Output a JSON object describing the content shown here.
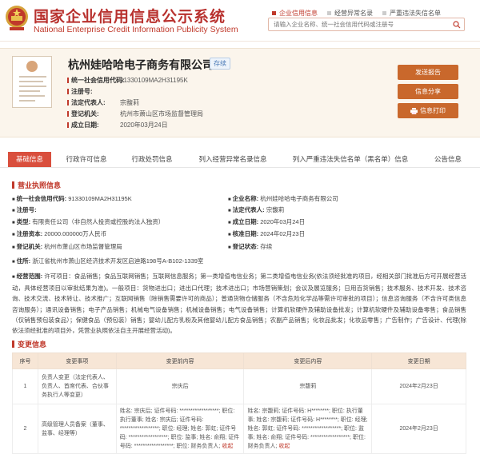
{
  "header": {
    "logo_cn": "国家企业信用信息公示系统",
    "logo_en": "National Enterprise Credit Information Publicity System",
    "nav": [
      "企业信用信息",
      "经营异常名录",
      "严重违法失信名单"
    ],
    "search_placeholder": "请输入企业名称、统一社会信用代码或注册号"
  },
  "company": {
    "name": "杭州娃哈哈电子商务有限公司",
    "status": "存续",
    "info": [
      {
        "label": "统一社会信用代码:",
        "value": "91330109MA2H31195K"
      },
      {
        "label": "注册号:",
        "value": ""
      },
      {
        "label": "法定代表人:",
        "value": "宗馥莉"
      },
      {
        "label": "登记机关:",
        "value": "杭州市萧山区市场监督管理局"
      },
      {
        "label": "成立日期:",
        "value": "2020年03月24日"
      }
    ],
    "buttons": [
      "发送报告",
      "信息分享",
      "信息打印"
    ]
  },
  "tabs": [
    "基础信息",
    "行政许可信息",
    "行政处罚信息",
    "列入经营异常名录信息",
    "列入严重违法失信名单（黑名单）信息",
    "公告信息"
  ],
  "license_section": {
    "title": "营业执照信息",
    "items": [
      {
        "label": "统一社会信用代码:",
        "value": "91330109MA2H31195K"
      },
      {
        "label": "企业名称:",
        "value": "杭州娃哈哈电子商务有限公司"
      },
      {
        "label": "注册号:",
        "value": ""
      },
      {
        "label": "法定代表人:",
        "value": "宗馥莉"
      },
      {
        "label": "类型:",
        "value": "有限责任公司（非自然人投资或控股的法人独资）"
      },
      {
        "label": "成立日期:",
        "value": "2020年03月24日"
      },
      {
        "label": "注册资本:",
        "value": "20000.000000万人民币"
      },
      {
        "label": "核准日期:",
        "value": "2024年02月23日"
      },
      {
        "label": "登记机关:",
        "value": "杭州市萧山区市场监督管理局"
      },
      {
        "label": "登记状态:",
        "value": "存续"
      },
      {
        "label": "住所:",
        "value": "浙江省杭州市萧山区经济技术开发区启迪路198号A-B102-1339室"
      }
    ],
    "scope_label": "经营范围:",
    "scope_text": "许可项目：食品销售；食品互联网销售；互联网信息服务；第一类增值电信业务；第二类增值电信业务(依法须经批准的项目，经相关部门批准后方可开展经营活动，具体经营项目以审批结果为准)。一般项目：货物进出口；进出口代理；技术进出口；市场营销策划；会议及展览服务；日用百货销售；技术服务、技术开发、技术咨询、技术交流、技术转让、技术推广；互联网销售（除销售需要许可的商品）；普通货物仓储服务（不含危险化学品等需许可审批的项目）；信息咨询服务（不含许可类信息咨询服务）；通讯设备销售；电子产品销售；机械电气设备销售；机械设备销售；电气设备销售；计算机软硬件及辅助设备批发；计算机软硬件及辅助设备零售；食品销售（仅销售预包装食品）；保健食品（预包装）销售；婴幼儿配方乳粉及其他婴幼儿配方食品销售；农副产品销售；化妆品批发；化妆品零售；广告制作；广告设计、代理(除依法须经批准的项目外，凭营业执照依法自主开展经营活动)。"
  },
  "change_section": {
    "title": "变更信息",
    "headers": [
      "序号",
      "变更事项",
      "变更前内容",
      "变更后内容",
      "变更日期"
    ],
    "rows": [
      {
        "no": "1",
        "item": "负责人变更（法定代表人、负责人、首席代表、合伙事务执行人等变更）",
        "before": "宗庆后",
        "after": "宗馥莉",
        "date": "2024年2月23日"
      },
      {
        "no": "2",
        "item": "高级管理人员备案（董事、监事、经理等）",
        "before": "姓名: 宗庆后; 证件号码: ******************; 职位: 执行董事; 姓名: 宗庆后; 证件号码: ******************; 职位: 经理; 姓名: 郭虹; 证件号码: ******************; 职位: 监事; 姓名: 俞翔; 证件号码: ******************; 职位: 财务负责人;",
        "before_tag": "收起",
        "after": "姓名: 宗馥莉; 证件号码: H********; 职位: 执行董事; 姓名: 宗馥莉; 证件号码: H********; 职位: 经理; 姓名: 郭虹; 证件号码: ******************; 职位: 监事; 姓名: 俞翔; 证件号码: ******************; 职位: 财务负责人;",
        "after_tag": "收起",
        "date": "2024年2月23日"
      }
    ]
  },
  "colors": {
    "brand_red": "#c0392b",
    "button_orange": "#c9682c",
    "tab_active": "#d94f3d"
  }
}
